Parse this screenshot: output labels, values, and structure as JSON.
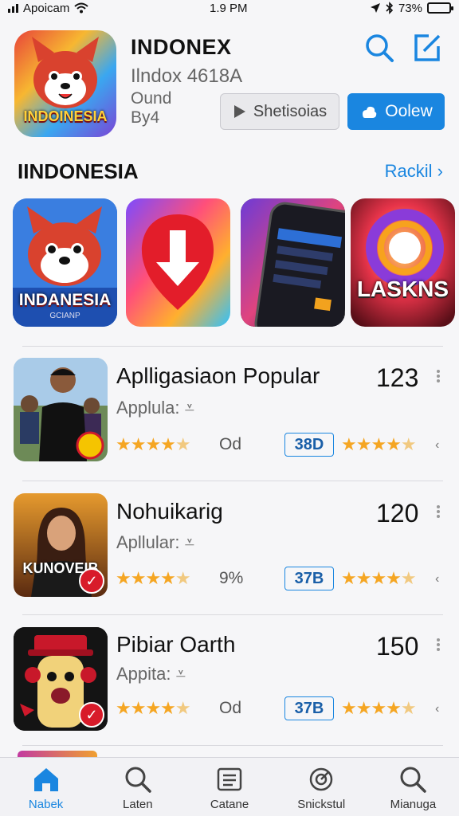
{
  "status_bar": {
    "carrier": "Apoicam",
    "time": "1.9 PM",
    "battery": "73%",
    "battery_level": 0.73
  },
  "hero_app": {
    "icon_text": "INDOINESIA",
    "title": "INDONEX",
    "subtitle": "Ilndox 4618A",
    "meta_line1": "Ound",
    "meta_line2": "By4",
    "screenshots_button": "Shetisoias",
    "open_button": "Oolew"
  },
  "section": {
    "title": "IINDONESIA",
    "link": "Rackil",
    "tiles": [
      {
        "label": "INDANESIA",
        "caption": "GCIANP"
      },
      {
        "label": ""
      },
      {
        "label": ""
      },
      {
        "label": "LASKNS"
      }
    ]
  },
  "list": [
    {
      "name": "Aplligasiaon Popular",
      "sub": "Applula:",
      "count": "123",
      "stat": "Od",
      "badge": "38D",
      "rating1": 4.5,
      "rating2": 4.5
    },
    {
      "name": "Nohuikarig",
      "sub": "Apllular:",
      "count": "120",
      "stat": "9%",
      "badge": "37B",
      "thumb_text": "KUNOVEIB",
      "rating1": 4.5,
      "rating2": 4.5
    },
    {
      "name": "Pibiar Oarth",
      "sub": "Appita:",
      "count": "150",
      "stat": "Od",
      "badge": "37B",
      "rating1": 4.5,
      "rating2": 4.5
    }
  ],
  "tabs": [
    {
      "label": "Nabek",
      "icon": "home-icon",
      "active": true
    },
    {
      "label": "Laten",
      "icon": "search-icon"
    },
    {
      "label": "Catane",
      "icon": "list-icon"
    },
    {
      "label": "Snickstul",
      "icon": "radar-icon"
    },
    {
      "label": "Mianuga",
      "icon": "search-icon"
    }
  ],
  "colors": {
    "accent": "#1a86e0",
    "star": "#f5a623",
    "badge_red": "#d81b2a"
  }
}
